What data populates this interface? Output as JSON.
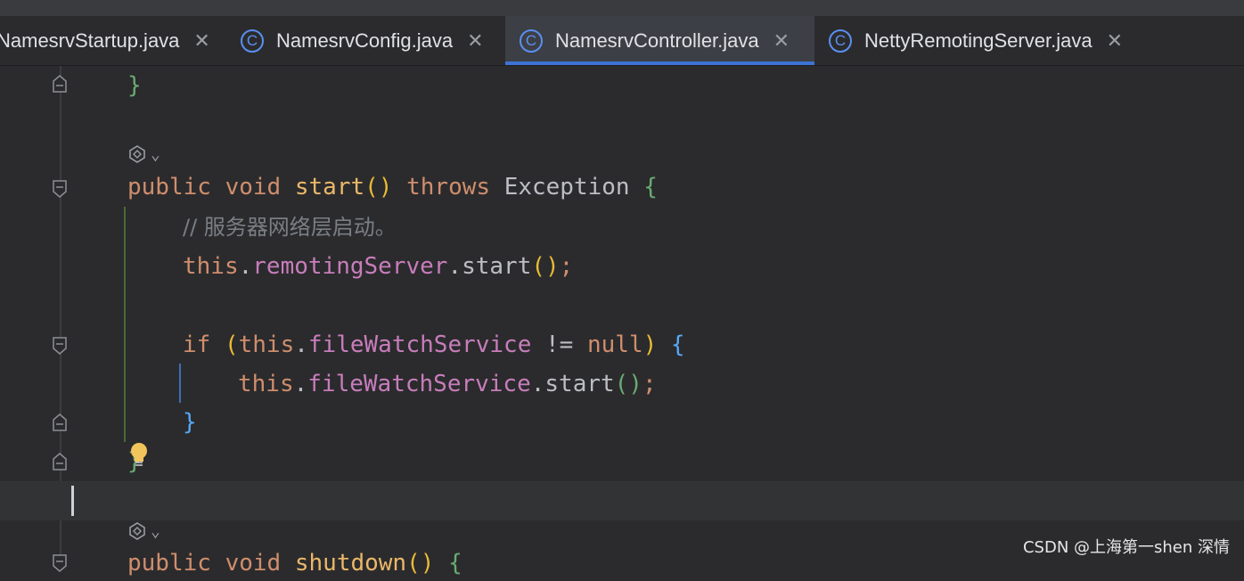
{
  "tabs": [
    {
      "label": "NamesrvStartup.java",
      "active": false,
      "icon": "class-icon"
    },
    {
      "label": "NamesrvConfig.java",
      "active": false,
      "icon": "class-icon"
    },
    {
      "label": "NamesrvController.java",
      "active": true,
      "icon": "class-icon"
    },
    {
      "label": "NettyRemotingServer.java",
      "active": false,
      "icon": "class-icon"
    }
  ],
  "tab_icon_glyph": "C",
  "close_glyph": "✕",
  "code": {
    "line1": {
      "brace": "}"
    },
    "line_start": {
      "kw1": "public",
      "kw2": "void",
      "name": "start",
      "parens": "()",
      "kw3": "throws",
      "type": "Exception",
      "brace": "{"
    },
    "line_comment": {
      "text": "// 服务器网络层启动。"
    },
    "line_remoting": {
      "this": "this",
      "dot1": ".",
      "field": "remotingServer",
      "rest": ".start",
      "parens": "()",
      "semi": ";"
    },
    "line_if": {
      "kw": "if",
      "open": "(",
      "this": "this",
      "dot": ".",
      "field": "fileWatchService",
      "op": " != ",
      "null": "null",
      "close": ")",
      "brace": "{"
    },
    "line_fw": {
      "this": "this",
      "dot": ".",
      "field": "fileWatchService",
      "rest": ".start",
      "parens": "()",
      "semi": ";"
    },
    "line_close_if": {
      "brace": "}"
    },
    "line_close_method": {
      "brace": "}"
    },
    "line_shutdown": {
      "kw1": "public",
      "kw2": "void",
      "name": "shutdown",
      "parens": "()",
      "brace": "{"
    }
  },
  "hint_chevron": "⌄",
  "watermark": "CSDN @上海第一shen 深情",
  "colors": {
    "accent": "#3d74d5",
    "keyword": "#cf8e6d",
    "method": "#eab869",
    "field": "#c77dbb",
    "comment": "#7a7e85"
  }
}
